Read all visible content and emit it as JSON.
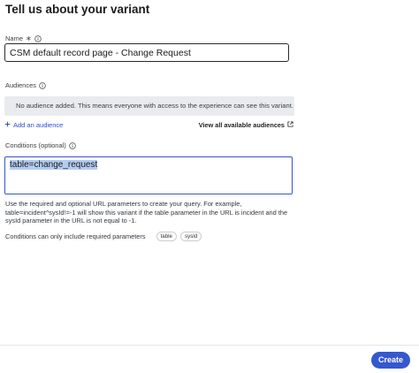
{
  "header": {
    "title": "Tell us about your variant"
  },
  "name_field": {
    "label": "Name",
    "required_mark": "∗",
    "value": "CSM default record page - Change Request"
  },
  "audiences": {
    "label": "Audiences",
    "empty_message": "No audience added. This means everyone with access to the experience can see this variant.",
    "add_label": "Add an audience",
    "view_all_label": "View all available audiences"
  },
  "conditions": {
    "label": "Conditions (optional)",
    "value": "table=change_request",
    "help_text": "Use the required and optional URL parameters to create your query. For example, table=incident^sysId!=-1 will show this variant if the table parameter in the URL is incident and the sysId parameter in the URL is not equal to -1.",
    "required_params_text": "Conditions can only include required parameters",
    "chips": [
      "table",
      "sysId"
    ]
  },
  "footer": {
    "create_label": "Create"
  },
  "colors": {
    "primary": "#3558cf",
    "link": "#2e4fc7",
    "focus_border": "#3556c9",
    "selection": "#b4ccf2",
    "empty_box": "#e9ebee"
  },
  "icons": [
    "info-icon",
    "plus-icon",
    "external-link-icon"
  ]
}
